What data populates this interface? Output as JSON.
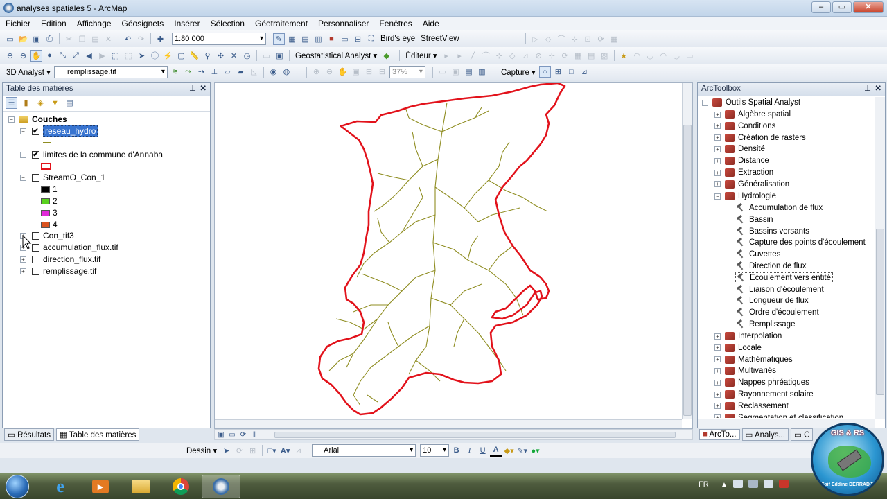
{
  "window": {
    "title": "analyses spatiales 5 - ArcMap",
    "minimize": "–",
    "maximize": "▭",
    "close": "✕"
  },
  "menu": [
    "Fichier",
    "Edition",
    "Affichage",
    "Géosignets",
    "Insérer",
    "Sélection",
    "Géotraitement",
    "Personnaliser",
    "Fenêtres",
    "Aide"
  ],
  "toolbar1": {
    "scale": "1:80 000",
    "birdseye": "Bird's eye",
    "streetview": "StreetView"
  },
  "toolbar2": {
    "geostat": "Geostatistical Analyst ▾",
    "editor": "Éditeur ▾"
  },
  "toolbar3": {
    "analyst3d": "3D Analyst ▾",
    "layer": "remplissage.tif",
    "zoom": "37%",
    "capture": "Capture ▾"
  },
  "toc": {
    "title": "Table des matières",
    "root": "Couches",
    "layers": [
      {
        "name": "reseau_hydro",
        "checked": "✔",
        "selected": true
      },
      {
        "name": "limites de la commune d'Annaba",
        "checked": "✔"
      },
      {
        "name": "StreamO_Con_1",
        "checked": ""
      },
      {
        "name": "Con_tif3",
        "checked": ""
      },
      {
        "name": "accumulation_flux.tif",
        "checked": ""
      },
      {
        "name": "direction_flux.tif",
        "checked": ""
      },
      {
        "name": "remplissage.tif",
        "checked": ""
      }
    ],
    "stream_classes": [
      {
        "label": "1",
        "color": "#000000"
      },
      {
        "label": "2",
        "color": "#59d21f"
      },
      {
        "label": "3",
        "color": "#e12ad9"
      },
      {
        "label": "4",
        "color": "#d9531f"
      }
    ],
    "tabs": {
      "results": "Résultats",
      "toc": "Table des matières"
    }
  },
  "map": {
    "boundary_color": "#e2121b",
    "river_color": "#8f8d21"
  },
  "toolbox": {
    "title": "ArcToolbox",
    "root": "Outils Spatial Analyst",
    "groups_before": [
      "Algèbre spatial",
      "Conditions",
      "Création de rasters",
      "Densité",
      "Distance",
      "Extraction",
      "Généralisation"
    ],
    "hydro": "Hydrologie",
    "hydro_tools": [
      "Accumulation de flux",
      "Bassin",
      "Bassins versants",
      "Capture des points d'écoulement",
      "Cuvettes",
      "Direction de flux",
      "Ecoulement vers entité",
      "Liaison d'écoulement",
      "Longueur de flux",
      "Ordre d'écoulement",
      "Remplissage"
    ],
    "groups_after": [
      "Interpolation",
      "Locale",
      "Mathématiques",
      "Multivariés",
      "Nappes phréatiques",
      "Rayonnement solaire",
      "Reclassement",
      "Segmentation et classification"
    ],
    "tabs": [
      "ArcTo...",
      "Analys...",
      "C"
    ]
  },
  "drawing": {
    "dessin": "Dessin ▾",
    "font": "Arial",
    "size": "10",
    "bold": "B",
    "italic": "I",
    "underline": "U"
  },
  "taskbar": {
    "lang": "FR"
  },
  "logo": {
    "text_top": "GIS & RS",
    "text_bottom": "Saif Eddine DERRADJI"
  }
}
